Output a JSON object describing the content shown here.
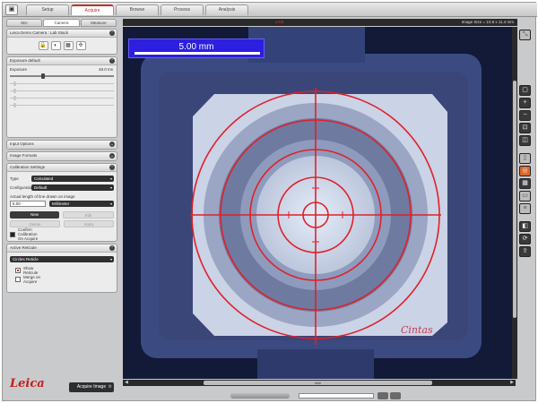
{
  "top_tabs": [
    "Setup",
    "Acquire",
    "Browse",
    "Process",
    "Analysis"
  ],
  "left_tabs": [
    "Mcr",
    "Camera",
    "Measure"
  ],
  "camera_section": {
    "title": "Leica Demo Camera : Lab Stack"
  },
  "exposure_section": {
    "title": "Exposure default",
    "exposure_label": "Exposure",
    "exposure_value": "48.0 ms",
    "exposure_level": 0.3
  },
  "collapsed_sections": [
    "Input Options",
    "Image Formats"
  ],
  "calibration": {
    "title": "Calibration Settings",
    "type_label": "Type",
    "type_value": "Calculated",
    "config_label": "Configuration",
    "config_value": "Default",
    "length_label": "Actual length of line drawn on image",
    "length_value": "5.00",
    "unit_value": "Millimeter",
    "buttons": [
      "New",
      "Edit",
      "Delete",
      "Apply"
    ],
    "confirm_label": "Confirm Calibration On Acquire"
  },
  "reticule": {
    "title": "Active Reticule",
    "selected": "Circles Reticle",
    "show_label": "Show Reticule",
    "merge_label": "Merge on Acquire"
  },
  "brand": "Leica",
  "acquire_button": "Acquire Image",
  "viewer": {
    "header_red": "LIVE",
    "image_size": "Image Size = 10.8 x 11.4 mm",
    "scalebar_text": "5.00 mm",
    "watermark": "Cintas"
  },
  "hscroll_label": "###",
  "icons": {
    "app_menu": "camera-icon",
    "gear": "gear-icon",
    "right_tools": [
      "fit-icon",
      "select-icon",
      "zoom-in-icon",
      "zoom-out-icon",
      "zoom-fit-icon",
      "overlay-icon",
      "ruler-icon",
      "reticule-icon",
      "grid-icon",
      "compare-icon",
      "list-icon",
      "split-icon",
      "rotate-icon",
      "export-icon"
    ]
  },
  "colors": {
    "accent": "#c0302a",
    "reticule": "#e0202a",
    "scalebar": "#2d1fe0"
  }
}
